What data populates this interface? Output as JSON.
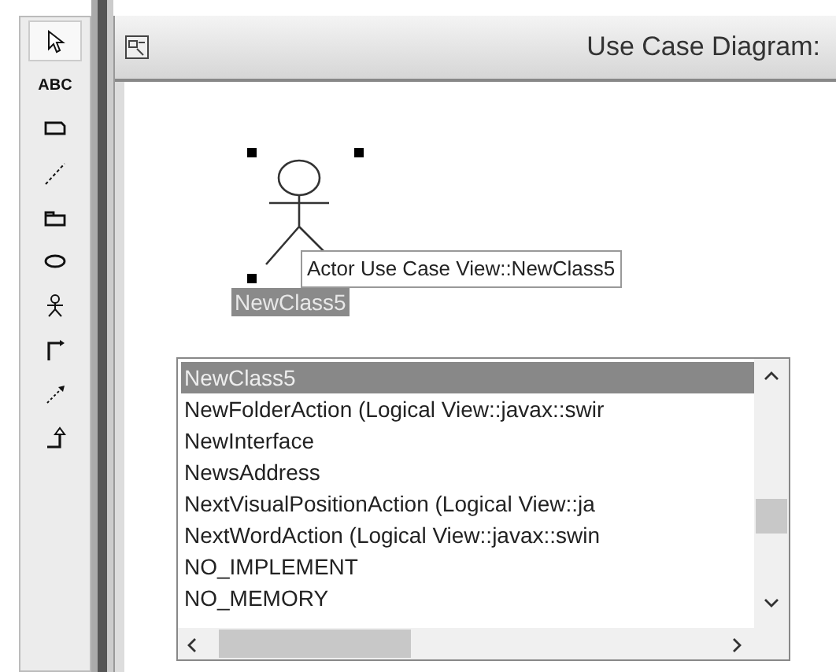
{
  "toolbox": {
    "tools": [
      {
        "kind": "pointer",
        "selected": true
      },
      {
        "kind": "text",
        "label": "ABC",
        "selected": false
      },
      {
        "kind": "note",
        "selected": false
      },
      {
        "kind": "anchor",
        "selected": false
      },
      {
        "kind": "package",
        "selected": false
      },
      {
        "kind": "usecase",
        "selected": false
      },
      {
        "kind": "actor",
        "selected": false
      },
      {
        "kind": "association",
        "selected": false
      },
      {
        "kind": "dependency",
        "selected": false
      },
      {
        "kind": "generalization",
        "selected": false
      }
    ]
  },
  "window": {
    "title": "Use Case Diagram:"
  },
  "diagram": {
    "actor": {
      "name": "NewClass5",
      "selected": true
    },
    "tooltip": "Actor Use Case View::NewClass5"
  },
  "completion_list": {
    "items": [
      {
        "label": "NewClass5",
        "selected": true
      },
      {
        "label": "NewFolderAction (Logical View::javax::swir",
        "selected": false
      },
      {
        "label": "NewInterface",
        "selected": false
      },
      {
        "label": "NewsAddress",
        "selected": false
      },
      {
        "label": "NextVisualPositionAction (Logical View::ja",
        "selected": false
      },
      {
        "label": "NextWordAction (Logical View::javax::swin",
        "selected": false
      },
      {
        "label": "NO_IMPLEMENT",
        "selected": false
      },
      {
        "label": "NO_MEMORY",
        "selected": false
      }
    ]
  }
}
